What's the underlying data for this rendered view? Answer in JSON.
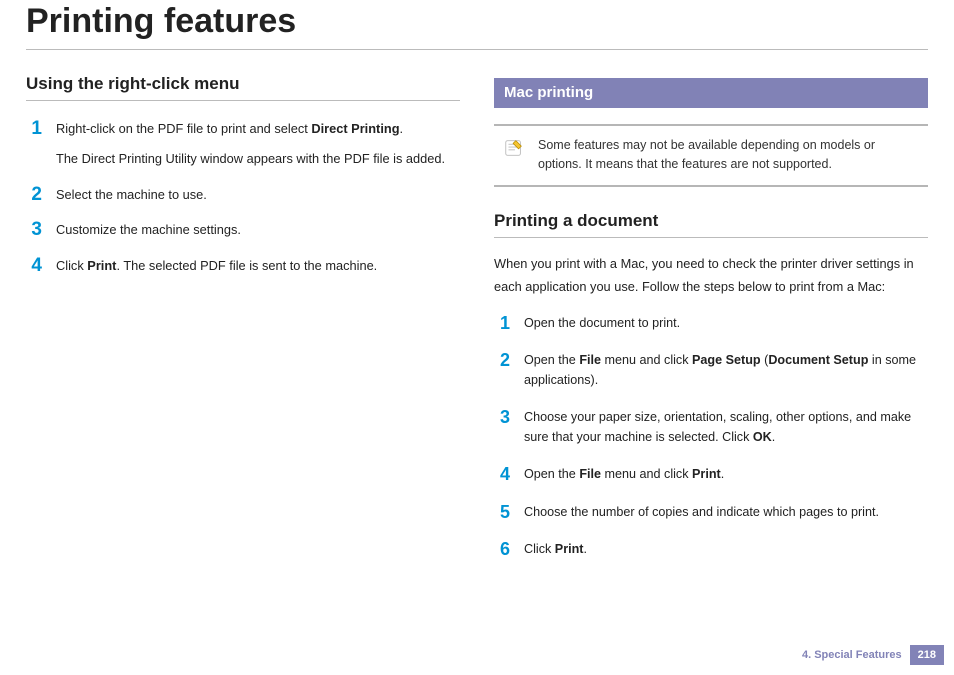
{
  "title": "Printing features",
  "left": {
    "heading": "Using the right-click menu",
    "steps": [
      {
        "num": "1",
        "text1_a": "Right-click on the PDF file to print and select ",
        "text1_b": "Direct Printing",
        "text1_c": ".",
        "text2": "The Direct Printing Utility window appears with the PDF file is added."
      },
      {
        "num": "2",
        "text": "Select the machine to use."
      },
      {
        "num": "3",
        "text": "Customize the machine settings."
      },
      {
        "num": "4",
        "text_a": "Click ",
        "text_b": "Print",
        "text_c": ". The selected PDF file is sent to the machine."
      }
    ]
  },
  "right": {
    "band": "Mac printing",
    "note": "Some features may not be available depending on models or options. It means that the features are not supported.",
    "heading": "Printing a document",
    "intro": "When you print with a Mac, you need to check the printer driver settings in each application you use. Follow the steps below to print from a Mac:",
    "steps": [
      {
        "num": "1",
        "text": "Open the document to print."
      },
      {
        "num": "2",
        "a": "Open the ",
        "b": "File",
        "c": " menu and click ",
        "d": "Page Setup",
        "e": " (",
        "f": "Document Setup",
        "g": " in some applications)."
      },
      {
        "num": "3",
        "a": "Choose your paper size, orientation, scaling, other options, and make sure that your machine is selected. Click ",
        "b": "OK",
        "c": "."
      },
      {
        "num": "4",
        "a": "Open the ",
        "b": "File",
        "c": " menu and click ",
        "d": "Print",
        "e": "."
      },
      {
        "num": "5",
        "text": "Choose the number of copies and indicate which pages to print."
      },
      {
        "num": "6",
        "a": "Click ",
        "b": "Print",
        "c": "."
      }
    ]
  },
  "footer": {
    "chapter": "4.  Special Features",
    "page": "218"
  }
}
